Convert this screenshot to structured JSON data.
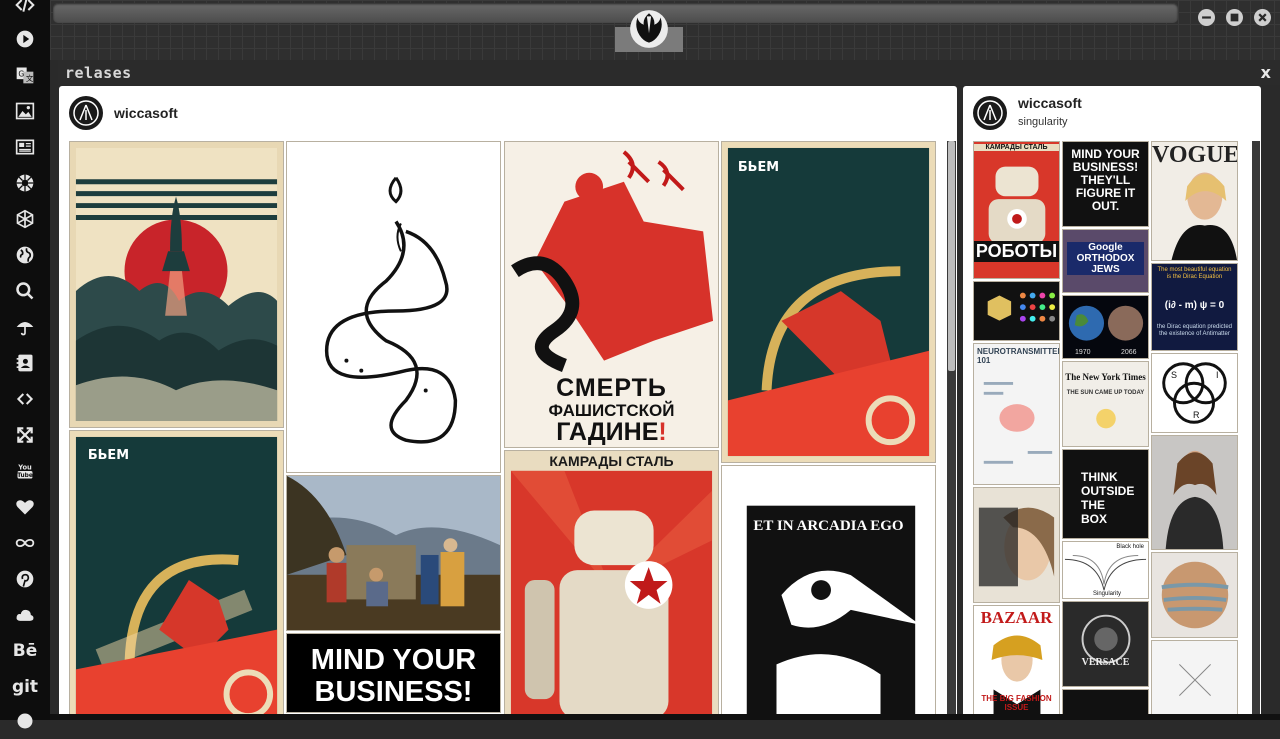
{
  "window": {
    "panel_title": "relases",
    "close_glyph": "x",
    "controls": [
      "minimize-icon",
      "maximize-icon",
      "close-icon"
    ]
  },
  "sidebar": {
    "items": [
      {
        "name": "code-icon"
      },
      {
        "name": "play-icon"
      },
      {
        "name": "translate-icon"
      },
      {
        "name": "image-icon"
      },
      {
        "name": "news-icon"
      },
      {
        "name": "galactic-empire-icon"
      },
      {
        "name": "hexagon-icon"
      },
      {
        "name": "globe-icon"
      },
      {
        "name": "search-icon"
      },
      {
        "name": "umbrella-icon"
      },
      {
        "name": "contacts-icon"
      },
      {
        "name": "share-icon"
      },
      {
        "name": "expand-icon"
      },
      {
        "name": "youtube-icon",
        "label": "You Tube"
      },
      {
        "name": "heart-icon"
      },
      {
        "name": "infinity-icon"
      },
      {
        "name": "pinterest-icon"
      },
      {
        "name": "cloud-icon"
      },
      {
        "name": "behance-icon",
        "label": "Bē"
      },
      {
        "name": "git-icon",
        "label": "git"
      }
    ]
  },
  "feed": {
    "author": "wiccasoft",
    "posters": {
      "smert_line1": "СМЕРТЬ",
      "smert_line2": "ФАШИСТСКОЙ",
      "smert_line3": "ГАДИНЕ",
      "smert_mark": "!",
      "bem": "БЬЕМ",
      "kamrady": "КАМРАДЫ СТАЛЬ",
      "roboty": "РОБОТЫ",
      "arcadia": "ET IN ARCADIA EGO",
      "mind1": "MIND YOUR",
      "mind2": "BUSINESS!"
    }
  },
  "board": {
    "author": "wiccasoft",
    "name": "singularity",
    "pins": {
      "kamrady": "КАМРАДЫ СТАЛЬ",
      "roboty": "РОБОТЫ",
      "mind": "MIND YOUR BUSINESS! THEY'LL FIGURE IT OUT.",
      "vogue": "VOGUE",
      "google": "Google ORTHODOX JEWS",
      "dirac_head": "The most beautiful equation is the Dirac Equation",
      "dirac_eq": "(i∂ - m) ψ = 0",
      "dirac_foot": "the Dirac equation predicted the existence of Antimatter",
      "year1": "1970",
      "year2": "2066",
      "neuro": "NEUROTRANSMITTERS 101",
      "nyt": "The New York Times",
      "sun": "THE SUN CAME UP TODAY",
      "think": "THINK OUTSIDE THE BOX",
      "sir_s": "S",
      "sir_i": "I",
      "sir_r": "R",
      "blackhole": "Black hole",
      "singularity": "Singularity",
      "versace": "VERSACE",
      "bazaar": "BAZAAR",
      "fashion": "THE BIG FASHION ISSUE"
    }
  }
}
